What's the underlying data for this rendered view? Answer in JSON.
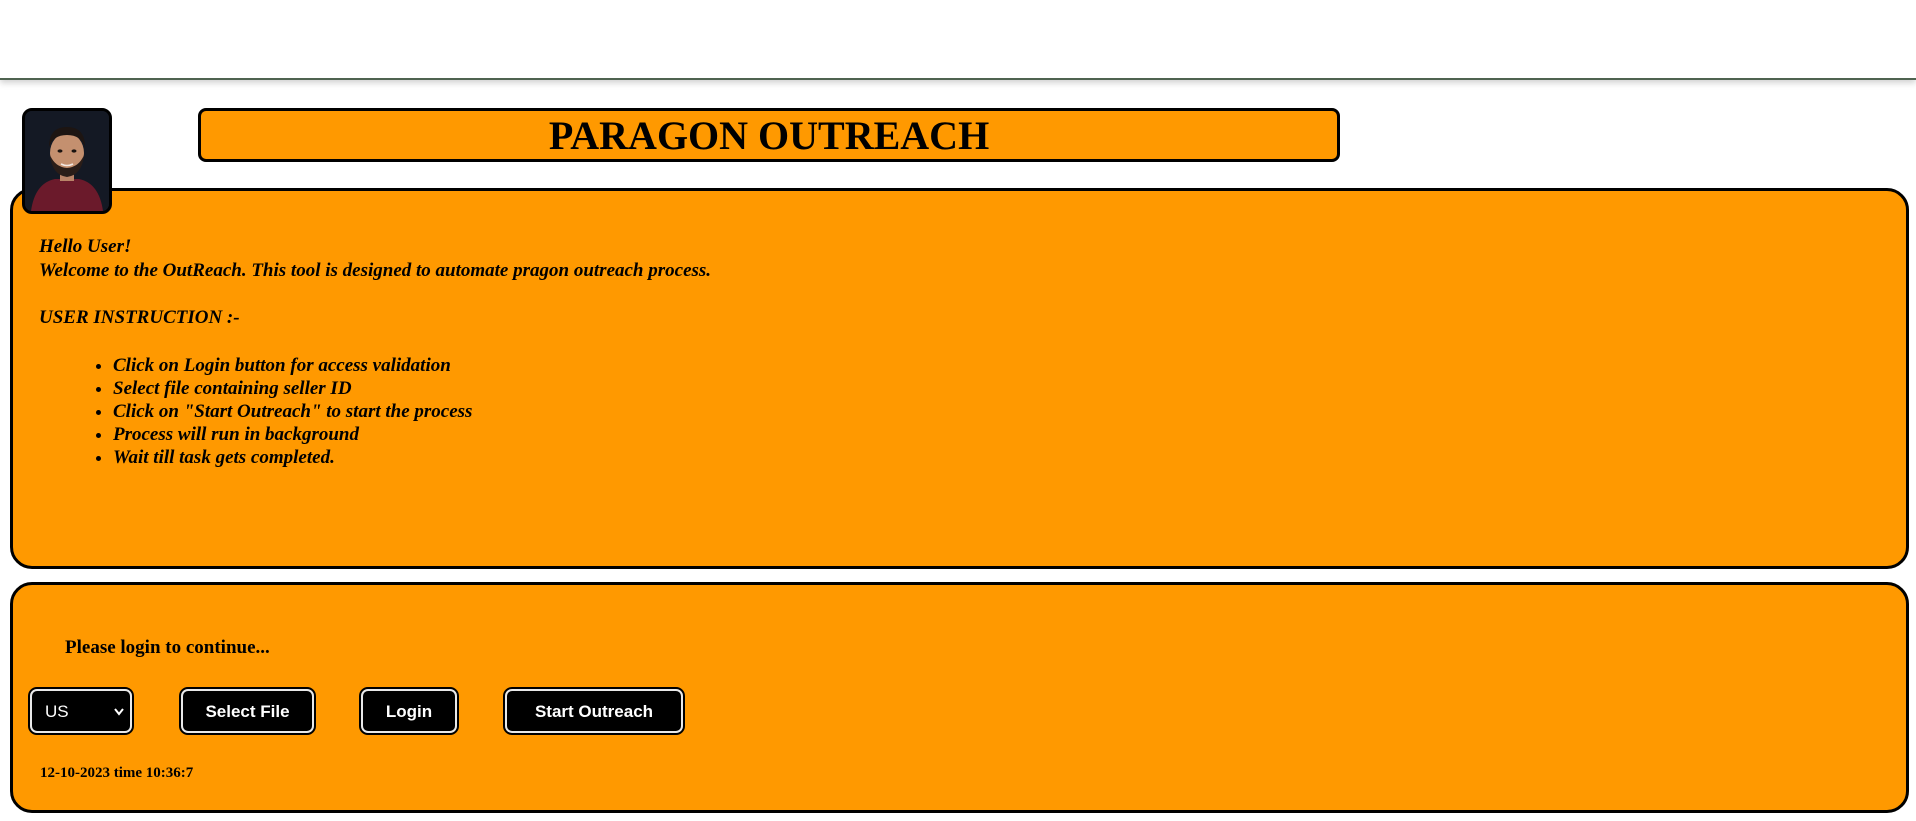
{
  "header": {
    "title": "PARAGON OUTREACH"
  },
  "avatar": {
    "icon": "user-photo"
  },
  "info": {
    "greeting": "Hello User!",
    "welcome": "Welcome to the OutReach. This tool is designed to automate pragon outreach process.",
    "instruction_title": "USER INSTRUCTION :-",
    "instructions": [
      "Click on Login button for access validation",
      "Select file containing seller ID",
      "Click on \"Start Outreach\" to start the process",
      "Process will run in background",
      "Wait till task gets completed."
    ]
  },
  "login": {
    "message": "Please login to continue...",
    "region_selected": "US",
    "select_file_label": "Select File",
    "login_label": "Login",
    "start_label": "Start Outreach",
    "timestamp": "12-10-2023 time 10:36:7"
  },
  "colors": {
    "panel": "#ff9900",
    "button": "#000000",
    "header_rule": "#4f6350"
  }
}
